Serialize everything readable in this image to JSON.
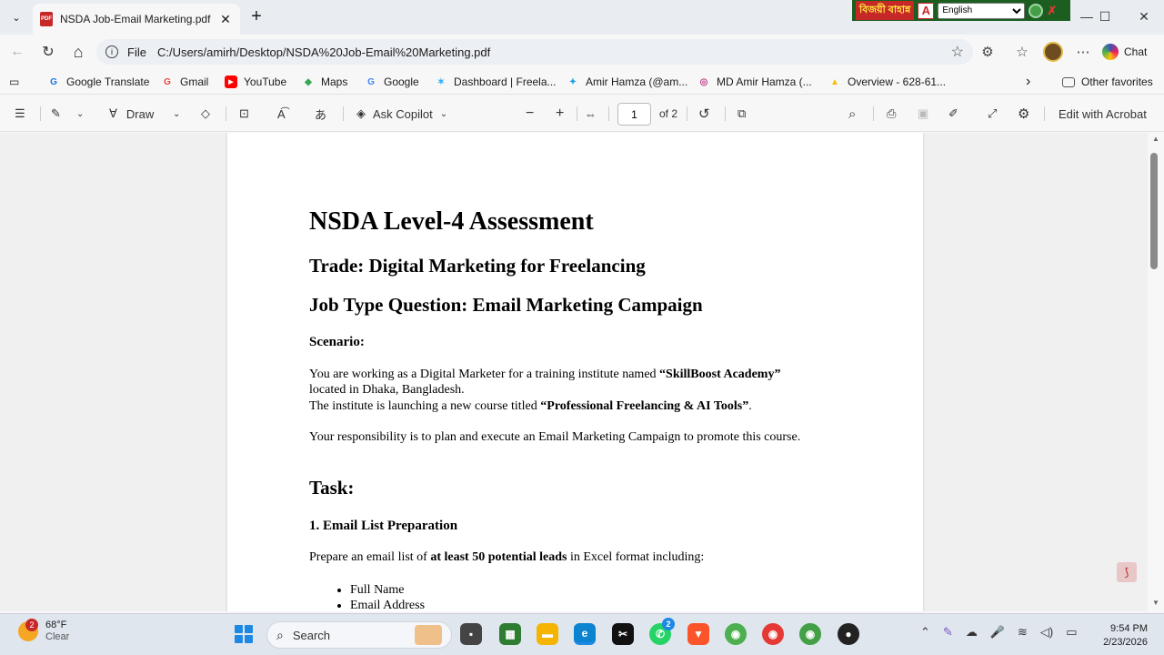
{
  "browser": {
    "tab_title": "NSDA Job-Email Marketing.pdf",
    "tab_close": "✕",
    "new_tab": "+",
    "tab_list_icon": "chevron-down-icon",
    "window_controls": {
      "minimize": "—",
      "maximize": "☐",
      "close": "✕"
    }
  },
  "ime": {
    "bangla_label": "বিজয়ী বাহান্ন",
    "logo_letter": "A",
    "language": "English"
  },
  "address_bar": {
    "scheme_label": "File",
    "url": "C:/Users/amirh/Desktop/NSDA%20Job-Email%20Marketing.pdf",
    "back": "←",
    "refresh": "↻",
    "home": "⌂",
    "chat_label": "Chat"
  },
  "bookmarks": [
    {
      "label": "Google Translate",
      "icon": "G",
      "color": "#1a73e8"
    },
    {
      "label": "Gmail",
      "icon": "G",
      "color": "#ea4335"
    },
    {
      "label": "YouTube",
      "icon": "▶",
      "color": "#ff0000"
    },
    {
      "label": "Maps",
      "icon": "◆",
      "color": "#34a853"
    },
    {
      "label": "Google",
      "icon": "G",
      "color": "#4285f4"
    },
    {
      "label": "Dashboard | Freela...",
      "icon": "✶",
      "color": "#29b2fe"
    },
    {
      "label": "Amir Hamza (@am...",
      "icon": "✦",
      "color": "#1da1f2"
    },
    {
      "label": "MD Amir Hamza (...",
      "icon": "◎",
      "color": "#c13584"
    },
    {
      "label": "Overview - 628-61...",
      "icon": "▲",
      "color": "#fbbc04"
    }
  ],
  "bookmarks_more": "›",
  "other_favorites": "Other favorites",
  "pdf_toolbar": {
    "draw_label": "Draw",
    "copilot_label": "Ask Copilot",
    "zoom_out": "−",
    "zoom_in": "+",
    "page_number": "1",
    "page_total": "of 2",
    "edit_label": "Edit with Acrobat"
  },
  "document": {
    "title": "NSDA Level-4 Assessment",
    "trade": "Trade: Digital Marketing for Freelancing",
    "job_type": "Job Type Question: Email Marketing Campaign",
    "scenario_heading": "Scenario:",
    "p1_a": "You are working as a Digital Marketer for a training institute named ",
    "p1_bold": "“SkillBoost Academy”",
    "p1_b": "located in Dhaka, Bangladesh.",
    "p2_a": "The institute is launching a new course titled ",
    "p2_bold": "“Professional Freelancing & AI Tools”",
    "p2_end": ".",
    "p3": "Your responsibility is to plan and execute an Email Marketing Campaign to promote this course.",
    "task_heading": "Task:",
    "subtask_1": "1. Email List Preparation",
    "p4_a": "Prepare an email list of ",
    "p4_bold": "at least 50 potential leads",
    "p4_b": " in Excel format including:",
    "list_items": [
      "Full Name",
      "Email Address"
    ]
  },
  "taskbar": {
    "weather_badge": "2",
    "temperature": "68°F",
    "condition": "Clear",
    "search_placeholder": "Search",
    "time": "9:54 PM",
    "date": "2/23/2026",
    "whatsapp_badge": "2"
  }
}
